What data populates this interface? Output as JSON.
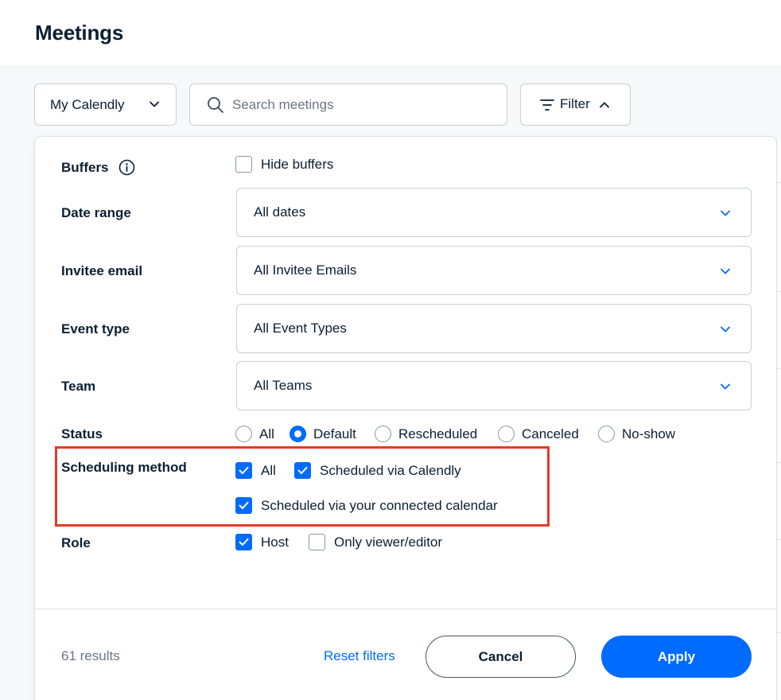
{
  "page": {
    "title": "Meetings"
  },
  "toolbar": {
    "calendar_select": "My Calendly",
    "search_placeholder": "Search meetings",
    "search_value": "",
    "filter_label": "Filter"
  },
  "filters": {
    "buffers": {
      "label": "Buffers",
      "option": "Hide buffers",
      "checked": false
    },
    "date_range": {
      "label": "Date range",
      "value": "All dates"
    },
    "invitee_email": {
      "label": "Invitee email",
      "value": "All Invitee Emails"
    },
    "event_type": {
      "label": "Event type",
      "value": "All Event Types"
    },
    "team": {
      "label": "Team",
      "value": "All Teams"
    },
    "status": {
      "label": "Status",
      "options": [
        "All",
        "Default",
        "Rescheduled",
        "Canceled",
        "No-show"
      ],
      "selected": "Default"
    },
    "scheduling_method": {
      "label": "Scheduling method",
      "options": [
        "All",
        "Scheduled via Calendly",
        "Scheduled via your connected calendar"
      ],
      "checked": [
        true,
        true,
        true
      ]
    },
    "role": {
      "label": "Role",
      "options": [
        "Host",
        "Only viewer/editor"
      ],
      "checked": [
        true,
        false
      ]
    }
  },
  "footer": {
    "results": "61 results",
    "reset_label": "Reset filters",
    "cancel_label": "Cancel",
    "apply_label": "Apply"
  },
  "colors": {
    "accent": "#006bff",
    "highlight_border": "#e23b26",
    "text": "#0b1f33",
    "muted": "#6b7785"
  }
}
